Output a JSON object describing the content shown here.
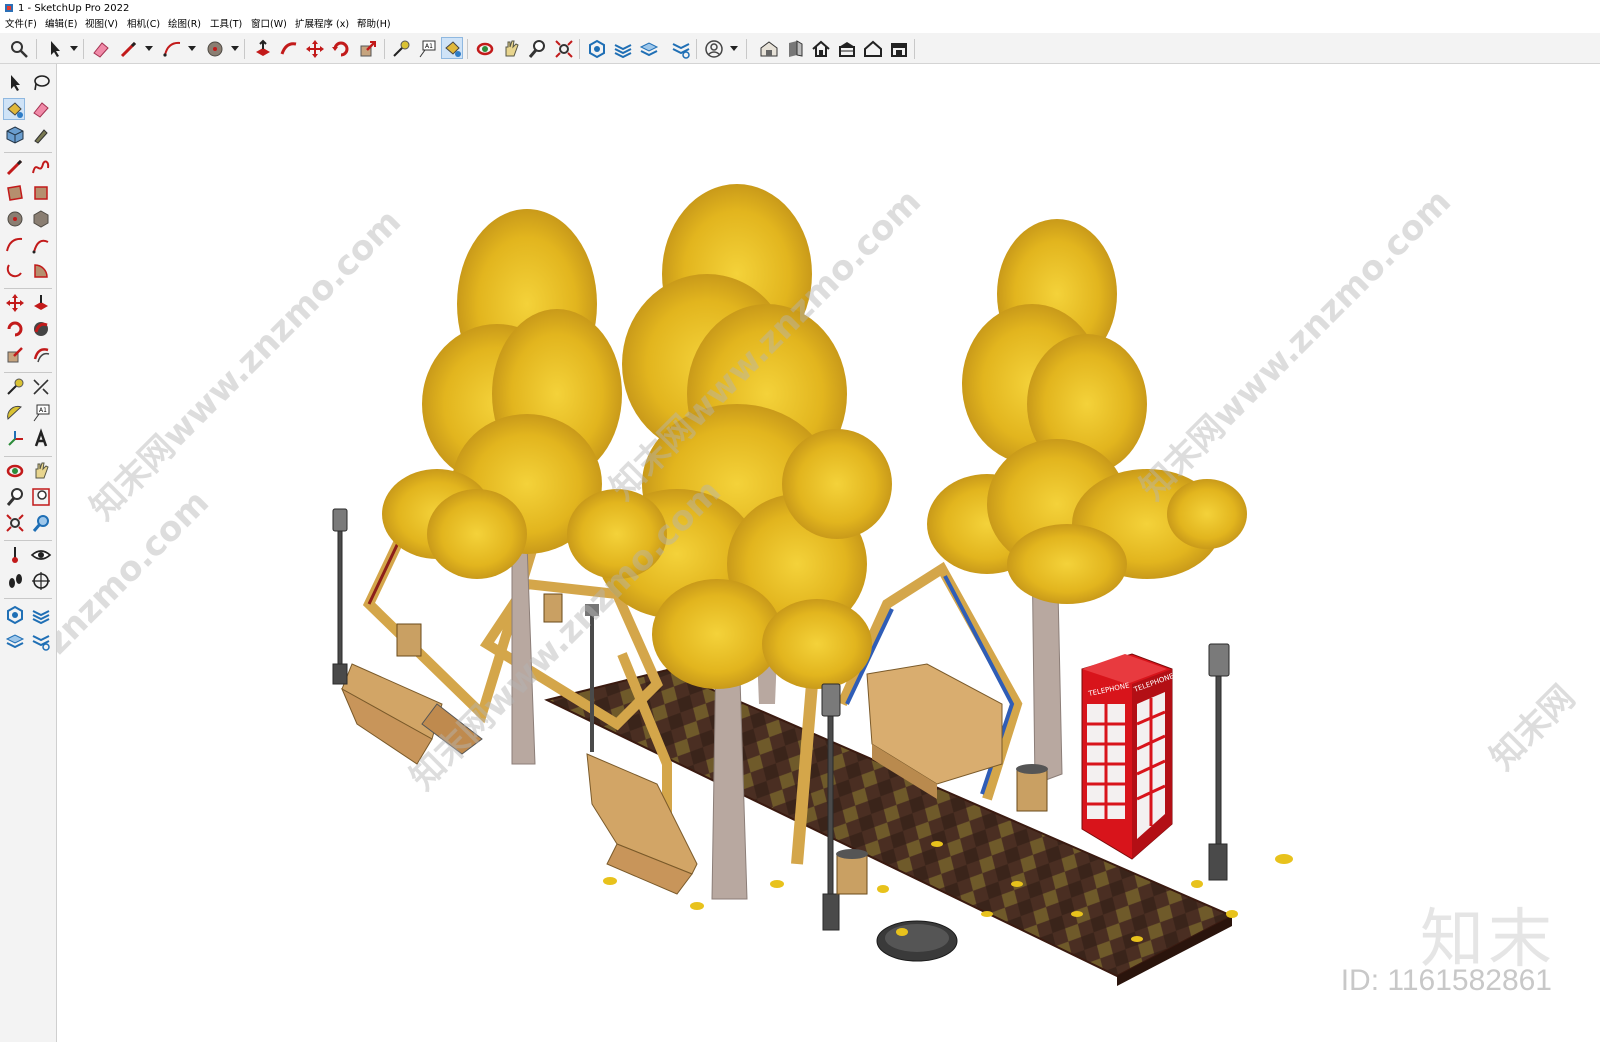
{
  "window": {
    "title": "1 - SketchUp Pro 2022"
  },
  "menu": [
    "文件(F)",
    "编辑(E)",
    "视图(V)",
    "相机(C)",
    "绘图(R)",
    "工具(T)",
    "窗口(W)",
    "扩展程序 (x)",
    "帮助(H)"
  ],
  "toolbar_icons": [
    "search-icon",
    "select-icon",
    "eraser-icon",
    "pencil-icon",
    "arc-icon",
    "circle-icon",
    "pushpull-icon",
    "followme-icon",
    "move-icon",
    "rotate-icon",
    "scale-icon",
    "tape-icon",
    "text-icon",
    "paint-bucket-icon",
    "orbit-icon",
    "pan-icon",
    "zoom-icon",
    "zoom-extents-icon",
    "sandbox-icon",
    "layers-icon",
    "stack-icon",
    "tag-icon",
    "account-icon",
    "warehouse-icon",
    "component-icon",
    "home-icon",
    "shed-icon",
    "house-icon",
    "store-icon"
  ],
  "watermarks": [
    "知末网www.znzmo.com",
    "知末网www.znzmo.com",
    "知末网www.znzmo.com",
    "知末网www.znzmo.com",
    "znzmo.com",
    "知末网"
  ],
  "brand": {
    "logo_text": "知末",
    "id_text": "ID: 1161582861"
  },
  "scene": {
    "booth_sign_left": "TELEPHONE",
    "booth_sign_right": "TELEPHONE"
  },
  "colors": {
    "foliage": "#e8c21c",
    "bark": "#b8a8a0",
    "booth": "#d8141b",
    "frame": "#d4a64a",
    "paving": "#4a2e22"
  }
}
